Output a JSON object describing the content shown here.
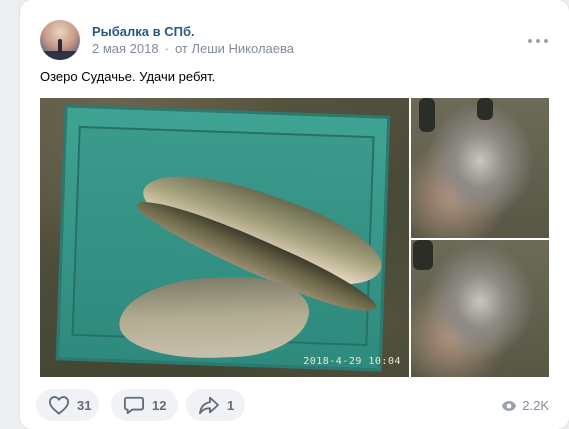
{
  "post": {
    "group_name": "Рыбалка в СПб.",
    "date": "2 мая 2018",
    "separator": "·",
    "from_text": "от Леши Николаева",
    "text": "Озеро Судачье. Удачи ребят.",
    "photo_timestamp": "2018-4-29  10:04"
  },
  "actions": {
    "likes": "31",
    "comments": "12",
    "shares": "1",
    "views": "2.2K"
  },
  "icons": {
    "more": "more-horizontal-icon",
    "like": "heart-outline-icon",
    "comment": "speech-bubble-icon",
    "share": "share-arrow-icon",
    "views": "eye-icon"
  }
}
